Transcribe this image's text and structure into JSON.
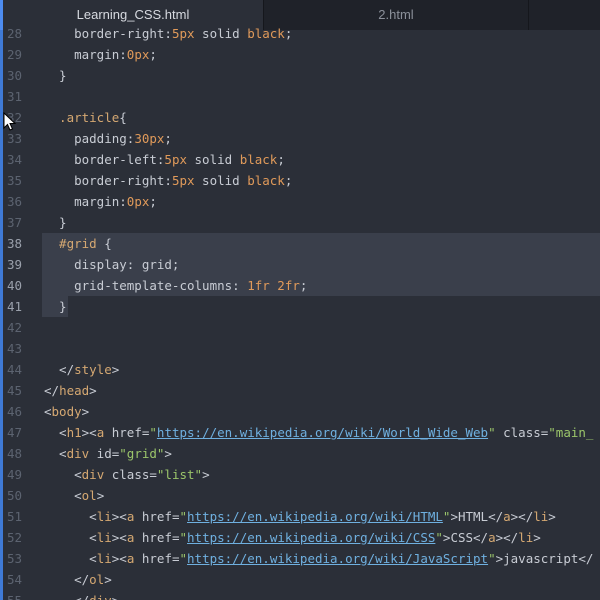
{
  "tabs": [
    {
      "label": "Learning_CSS.html",
      "active": true
    },
    {
      "label": "2.html",
      "active": false
    }
  ],
  "lines": [
    {
      "n": "28",
      "tokens": [
        {
          "t": "    border-right:",
          "c": "attr"
        },
        {
          "t": "5px",
          "c": "num"
        },
        {
          "t": " solid ",
          "c": "attr"
        },
        {
          "t": "black",
          "c": "num"
        },
        {
          "t": ";",
          "c": "attr"
        }
      ]
    },
    {
      "n": "29",
      "tokens": [
        {
          "t": "    margin:",
          "c": "attr"
        },
        {
          "t": "0px",
          "c": "num"
        },
        {
          "t": ";",
          "c": "attr"
        }
      ]
    },
    {
      "n": "30",
      "tokens": [
        {
          "t": "  }",
          "c": "attr"
        }
      ]
    },
    {
      "n": "31",
      "tokens": []
    },
    {
      "n": "32",
      "tokens": [
        {
          "t": "  .article",
          "c": "sel"
        },
        {
          "t": "{",
          "c": "attr"
        }
      ]
    },
    {
      "n": "33",
      "tokens": [
        {
          "t": "    padding:",
          "c": "attr"
        },
        {
          "t": "30px",
          "c": "num"
        },
        {
          "t": ";",
          "c": "attr"
        }
      ]
    },
    {
      "n": "34",
      "tokens": [
        {
          "t": "    border-left:",
          "c": "attr"
        },
        {
          "t": "5px",
          "c": "num"
        },
        {
          "t": " solid ",
          "c": "attr"
        },
        {
          "t": "black",
          "c": "num"
        },
        {
          "t": ";",
          "c": "attr"
        }
      ]
    },
    {
      "n": "35",
      "tokens": [
        {
          "t": "    border-right:",
          "c": "attr"
        },
        {
          "t": "5px",
          "c": "num"
        },
        {
          "t": " solid ",
          "c": "attr"
        },
        {
          "t": "black",
          "c": "num"
        },
        {
          "t": ";",
          "c": "attr"
        }
      ]
    },
    {
      "n": "36",
      "tokens": [
        {
          "t": "    margin:",
          "c": "attr"
        },
        {
          "t": "0px",
          "c": "num"
        },
        {
          "t": ";",
          "c": "attr"
        }
      ]
    },
    {
      "n": "37",
      "tokens": [
        {
          "t": "  }",
          "c": "attr"
        }
      ]
    },
    {
      "n": "38",
      "sel": true,
      "tokens": [
        {
          "t": "  #grid",
          "c": "sel"
        },
        {
          "t": " {",
          "c": "attr"
        }
      ]
    },
    {
      "n": "39",
      "sel": true,
      "tokens": [
        {
          "t": "    display: grid;",
          "c": "attr"
        }
      ]
    },
    {
      "n": "40",
      "sel": true,
      "tokens": [
        {
          "t": "    grid-template-columns: ",
          "c": "attr"
        },
        {
          "t": "1fr 2fr",
          "c": "num"
        },
        {
          "t": ";",
          "c": "attr"
        }
      ]
    },
    {
      "n": "41",
      "sel": true,
      "last": true,
      "tokens": [
        {
          "t": "  }",
          "c": "attr"
        }
      ]
    },
    {
      "n": "42",
      "tokens": []
    },
    {
      "n": "43",
      "tokens": []
    },
    {
      "n": "44",
      "tokens": [
        {
          "t": "  </",
          "c": "attr"
        },
        {
          "t": "style",
          "c": "tag"
        },
        {
          "t": ">",
          "c": "attr"
        }
      ]
    },
    {
      "n": "45",
      "tokens": [
        {
          "t": "</",
          "c": "attr"
        },
        {
          "t": "head",
          "c": "tag"
        },
        {
          "t": ">",
          "c": "attr"
        }
      ]
    },
    {
      "n": "46",
      "tokens": [
        {
          "t": "<",
          "c": "attr"
        },
        {
          "t": "body",
          "c": "tag"
        },
        {
          "t": ">",
          "c": "attr"
        }
      ]
    },
    {
      "n": "47",
      "tokens": [
        {
          "t": "  <",
          "c": "attr"
        },
        {
          "t": "h1",
          "c": "tag"
        },
        {
          "t": "><",
          "c": "attr"
        },
        {
          "t": "a",
          "c": "tag"
        },
        {
          "t": " href=",
          "c": "attr"
        },
        {
          "t": "\"",
          "c": "str"
        },
        {
          "t": "https://en.wikipedia.org/wiki/World_Wide_Web",
          "c": "link"
        },
        {
          "t": "\"",
          "c": "str"
        },
        {
          "t": " class=",
          "c": "attr"
        },
        {
          "t": "\"main_",
          "c": "str"
        }
      ]
    },
    {
      "n": "48",
      "tokens": [
        {
          "t": "  <",
          "c": "attr"
        },
        {
          "t": "div",
          "c": "tag"
        },
        {
          "t": " id=",
          "c": "attr"
        },
        {
          "t": "\"grid\"",
          "c": "str"
        },
        {
          "t": ">",
          "c": "attr"
        }
      ]
    },
    {
      "n": "49",
      "tokens": [
        {
          "t": "    <",
          "c": "attr"
        },
        {
          "t": "div",
          "c": "tag"
        },
        {
          "t": " class=",
          "c": "attr"
        },
        {
          "t": "\"list\"",
          "c": "str"
        },
        {
          "t": ">",
          "c": "attr"
        }
      ]
    },
    {
      "n": "50",
      "tokens": [
        {
          "t": "    <",
          "c": "attr"
        },
        {
          "t": "ol",
          "c": "tag"
        },
        {
          "t": ">",
          "c": "attr"
        }
      ]
    },
    {
      "n": "51",
      "tokens": [
        {
          "t": "      <",
          "c": "attr"
        },
        {
          "t": "li",
          "c": "tag"
        },
        {
          "t": "><",
          "c": "attr"
        },
        {
          "t": "a",
          "c": "tag"
        },
        {
          "t": " href=",
          "c": "attr"
        },
        {
          "t": "\"",
          "c": "str"
        },
        {
          "t": "https://en.wikipedia.org/wiki/HTML",
          "c": "link"
        },
        {
          "t": "\"",
          "c": "str"
        },
        {
          "t": ">HTML</",
          "c": "attr"
        },
        {
          "t": "a",
          "c": "tag"
        },
        {
          "t": "></",
          "c": "attr"
        },
        {
          "t": "li",
          "c": "tag"
        },
        {
          "t": ">",
          "c": "attr"
        }
      ]
    },
    {
      "n": "52",
      "tokens": [
        {
          "t": "      <",
          "c": "attr"
        },
        {
          "t": "li",
          "c": "tag"
        },
        {
          "t": "><",
          "c": "attr"
        },
        {
          "t": "a",
          "c": "tag"
        },
        {
          "t": " href=",
          "c": "attr"
        },
        {
          "t": "\"",
          "c": "str"
        },
        {
          "t": "https://en.wikipedia.org/wiki/CSS",
          "c": "link"
        },
        {
          "t": "\"",
          "c": "str"
        },
        {
          "t": ">CSS</",
          "c": "attr"
        },
        {
          "t": "a",
          "c": "tag"
        },
        {
          "t": "></",
          "c": "attr"
        },
        {
          "t": "li",
          "c": "tag"
        },
        {
          "t": ">",
          "c": "attr"
        }
      ]
    },
    {
      "n": "53",
      "tokens": [
        {
          "t": "      <",
          "c": "attr"
        },
        {
          "t": "li",
          "c": "tag"
        },
        {
          "t": "><",
          "c": "attr"
        },
        {
          "t": "a",
          "c": "tag"
        },
        {
          "t": " href=",
          "c": "attr"
        },
        {
          "t": "\"",
          "c": "str"
        },
        {
          "t": "https://en.wikipedia.org/wiki/JavaScript",
          "c": "link"
        },
        {
          "t": "\"",
          "c": "str"
        },
        {
          "t": ">javascript</",
          "c": "attr"
        }
      ]
    },
    {
      "n": "54",
      "tokens": [
        {
          "t": "    </",
          "c": "attr"
        },
        {
          "t": "ol",
          "c": "tag"
        },
        {
          "t": ">",
          "c": "attr"
        }
      ]
    },
    {
      "n": "55",
      "tokens": [
        {
          "t": "    </",
          "c": "attr"
        },
        {
          "t": "div",
          "c": "tag"
        },
        {
          "t": ">",
          "c": "attr"
        }
      ]
    }
  ],
  "cursor_icon": "mouse-pointer-icon"
}
